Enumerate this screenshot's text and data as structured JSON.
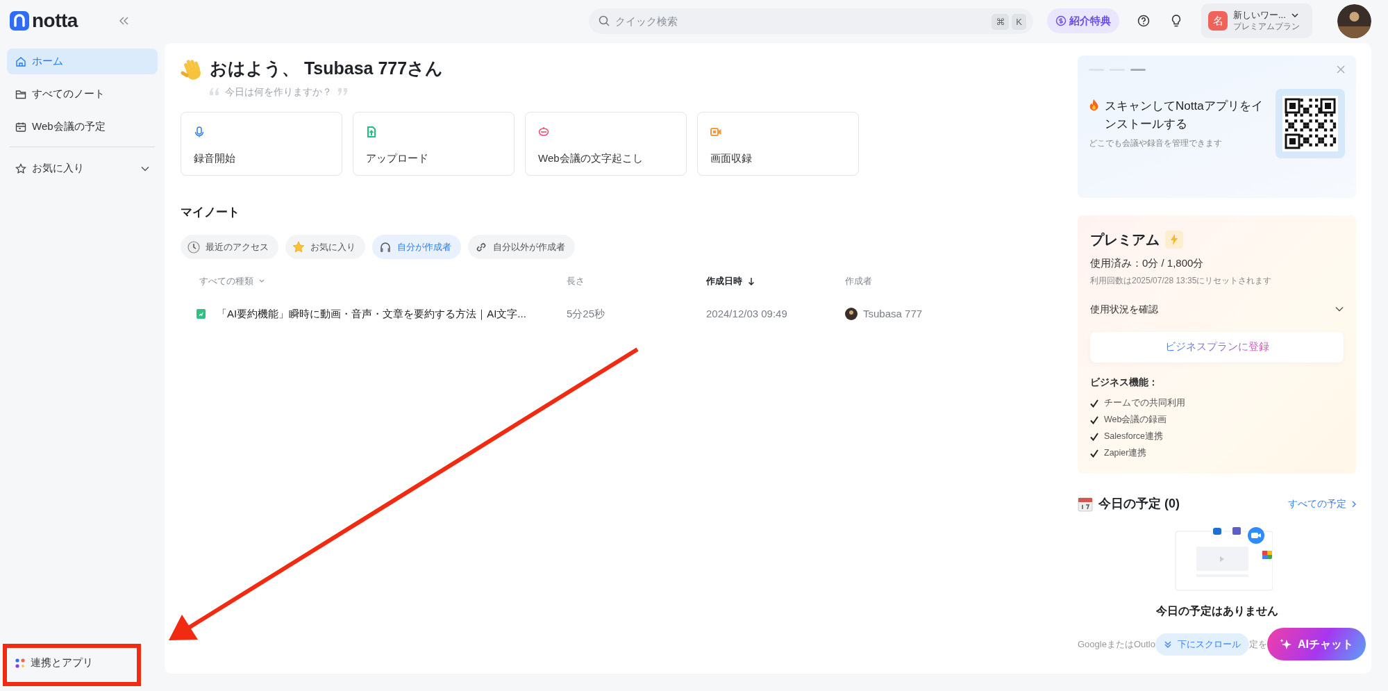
{
  "header": {
    "logo": "notta",
    "search": {
      "placeholder": "クイック検索",
      "keys": [
        "⌘",
        "K"
      ]
    },
    "referral": "紹介特典",
    "workspace": {
      "initial": "名",
      "name": "新しいワー...",
      "plan": "プレミアムプラン"
    }
  },
  "sidebar": {
    "items": [
      {
        "label": "ホーム",
        "selected": true
      },
      {
        "label": "すべてのノート",
        "selected": false
      },
      {
        "label": "Web会議の予定",
        "selected": false
      }
    ],
    "favorites": {
      "label": "お気に入り",
      "expanded": false
    },
    "footer": "連携とアプリ"
  },
  "greeting": {
    "title": "おはよう、 Tsubasa 777さん",
    "subtitle": "今日は何を作りますか？"
  },
  "actions": [
    {
      "label": "録音開始",
      "color": "#2f80ed"
    },
    {
      "label": "アップロード",
      "color": "#22c07a"
    },
    {
      "label": "Web会議の文字起こし",
      "color": "#f0436a"
    },
    {
      "label": "画面収録",
      "color": "#f59a3c"
    }
  ],
  "notes": {
    "title": "マイノート",
    "filters": [
      {
        "label": "最近のアクセス",
        "selected": false
      },
      {
        "label": "お気に入り",
        "selected": false
      },
      {
        "label": "自分が作成者",
        "selected": true
      },
      {
        "label": "自分以外が作成者",
        "selected": false
      }
    ],
    "columns": [
      {
        "label": "すべての種類",
        "sorted": false
      },
      {
        "label": "長さ",
        "sorted": false
      },
      {
        "label": "作成日時",
        "sorted": true
      },
      {
        "label": "作成者",
        "sorted": false
      }
    ],
    "rows": [
      {
        "title": "「AI要約機能」瞬時に動画・音声・文章を要約する方法｜AI文字...",
        "length": "5分25秒",
        "date": "2024/12/03 09:49",
        "owner": "Tsubasa 777"
      }
    ]
  },
  "app_promo": {
    "slides": [
      {
        "selected": false
      },
      {
        "selected": false
      },
      {
        "selected": true
      }
    ],
    "title": "スキャンしてNottaアプリをインストールする",
    "subtitle": "どこでも会議や録音を管理できます"
  },
  "premium": {
    "title": "プレミアム",
    "usage": "使用済み：0分 / 1,800分",
    "reset": "利用回数は2025/07/28 13:35にリセットされます",
    "usage_toggle": {
      "label": "使用状況を確認",
      "expanded": false
    },
    "button": "ビジネスプランに登録",
    "features_title": "ビジネス機能：",
    "features": [
      "チームでの共同利用",
      "Web会議の録画",
      "Salesforce連携",
      "Zapier連携"
    ]
  },
  "schedule": {
    "title": "今日の予定 (0)",
    "link": "すべての予定",
    "empty": "今日の予定はありません",
    "hint_parts": [
      "GoogleまたはOutlo",
      "定を"
    ],
    "scroll_button": "下にスクロール",
    "ai_button": "AIチャット"
  }
}
